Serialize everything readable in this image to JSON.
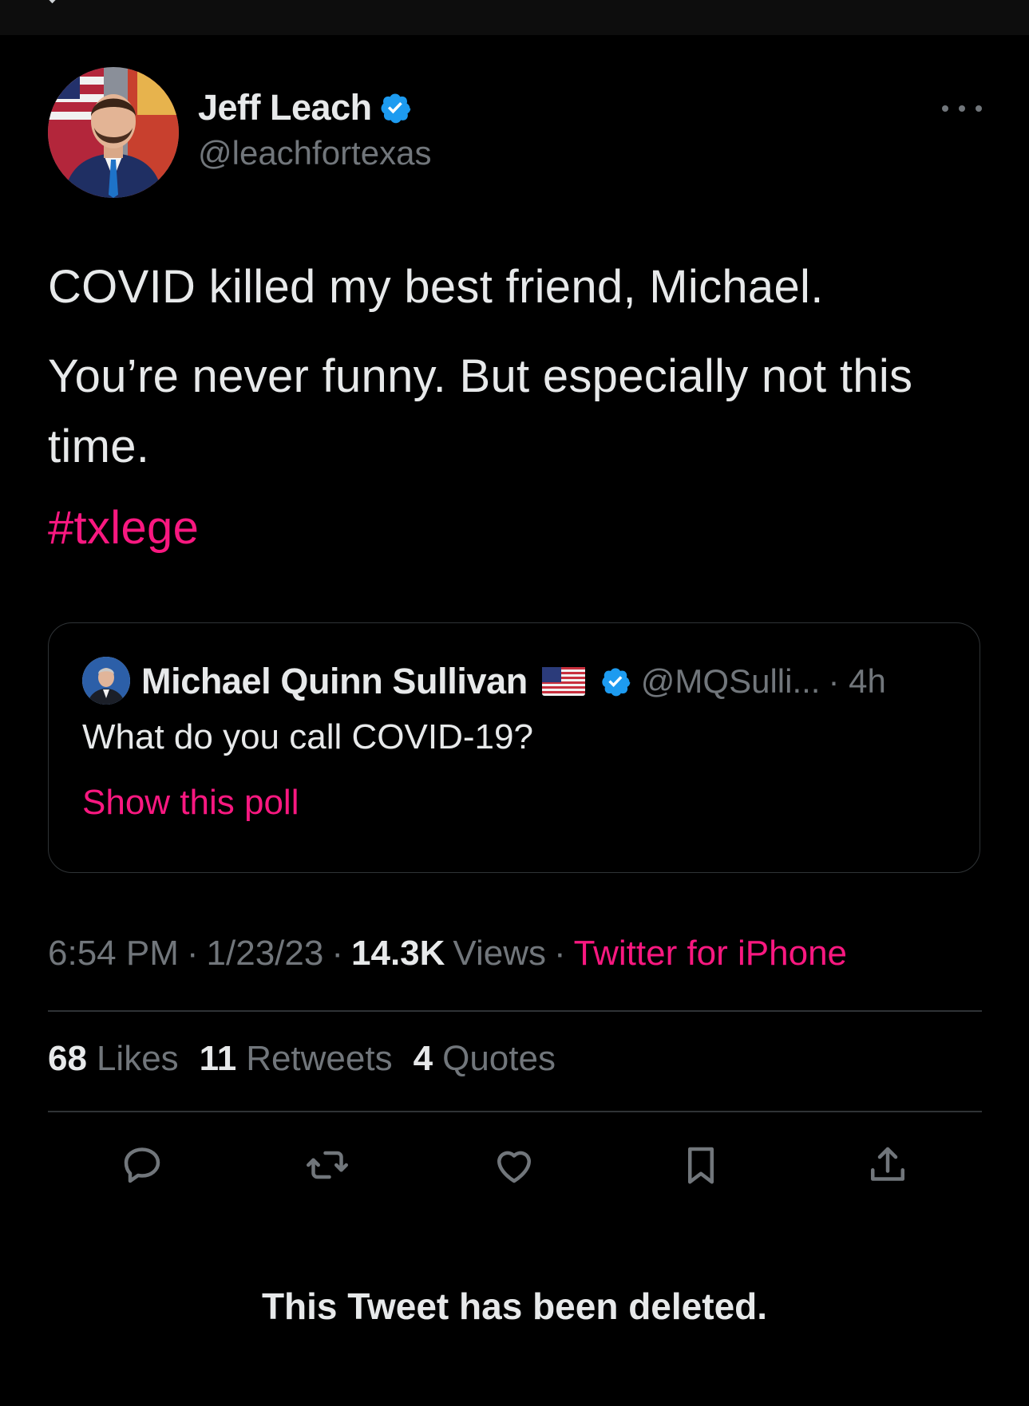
{
  "tweet": {
    "author_name": "Jeff Leach",
    "author_handle": "@leachfortexas",
    "text_line1": "COVID killed my best friend, Michael.",
    "text_line2": "You’re never funny. But especially not this time.",
    "hashtag": "#txlege"
  },
  "quote": {
    "name": "Michael Quinn Sullivan",
    "handle": "@MQSulli...",
    "time": "· 4h",
    "text": "What do you call COVID-19?",
    "poll_link": "Show this poll"
  },
  "meta": {
    "time": "6:54 PM",
    "date": "1/23/23",
    "views_count": "14.3K",
    "views_label": "Views",
    "source": "Twitter for iPhone"
  },
  "stats": {
    "likes_count": "68",
    "likes_label": "Likes",
    "retweets_count": "11",
    "retweets_label": "Retweets",
    "quotes_count": "4",
    "quotes_label": "Quotes"
  },
  "actions": [
    "reply-icon",
    "retweet-icon",
    "like-icon",
    "bookmark-icon",
    "share-icon"
  ],
  "footer": {
    "deleted_notice": "This Tweet has been deleted."
  },
  "colors": {
    "background": "#000000",
    "text": "#e7e9ea",
    "secondary": "#71767b",
    "accent": "#f91880",
    "verified": "#1d9bf0",
    "border": "#2f3336"
  }
}
